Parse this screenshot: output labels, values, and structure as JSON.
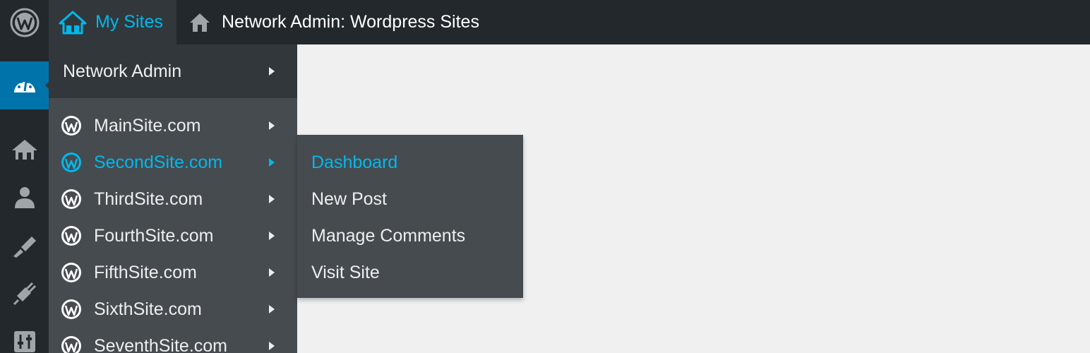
{
  "adminbar": {
    "wp_logo_icon": "wordpress-logo-icon",
    "my_sites_label": "My Sites",
    "my_sites_icon": "multisite-houses-icon",
    "site_icon": "home-icon",
    "site_label": "Network Admin: Wordpress Sites"
  },
  "adminmenu": {
    "icons": [
      "dashboard-gauge-icon",
      "sites-icon",
      "users-icon",
      "themes-brush-icon",
      "plugins-icon",
      "settings-sliders-icon"
    ]
  },
  "mysites_menu": {
    "network_admin_label": "Network Admin",
    "sites": [
      {
        "label": "MainSite.com"
      },
      {
        "label": "SecondSite.com",
        "active": true
      },
      {
        "label": "ThirdSite.com"
      },
      {
        "label": "FourthSite.com"
      },
      {
        "label": "FifthSite.com"
      },
      {
        "label": "SixthSite.com"
      },
      {
        "label": "SeventhSite.com"
      }
    ]
  },
  "site_submenu": {
    "items": [
      "Dashboard",
      "New Post",
      "Manage Comments",
      "Visit Site"
    ],
    "active_item": "Dashboard"
  },
  "colors": {
    "bar_bg": "#23282d",
    "menu_bg": "#32373c",
    "submenu_bg": "#464b50",
    "accent": "#00b9eb",
    "active_menu": "#0073aa",
    "content_bg": "#f0f0f1"
  }
}
